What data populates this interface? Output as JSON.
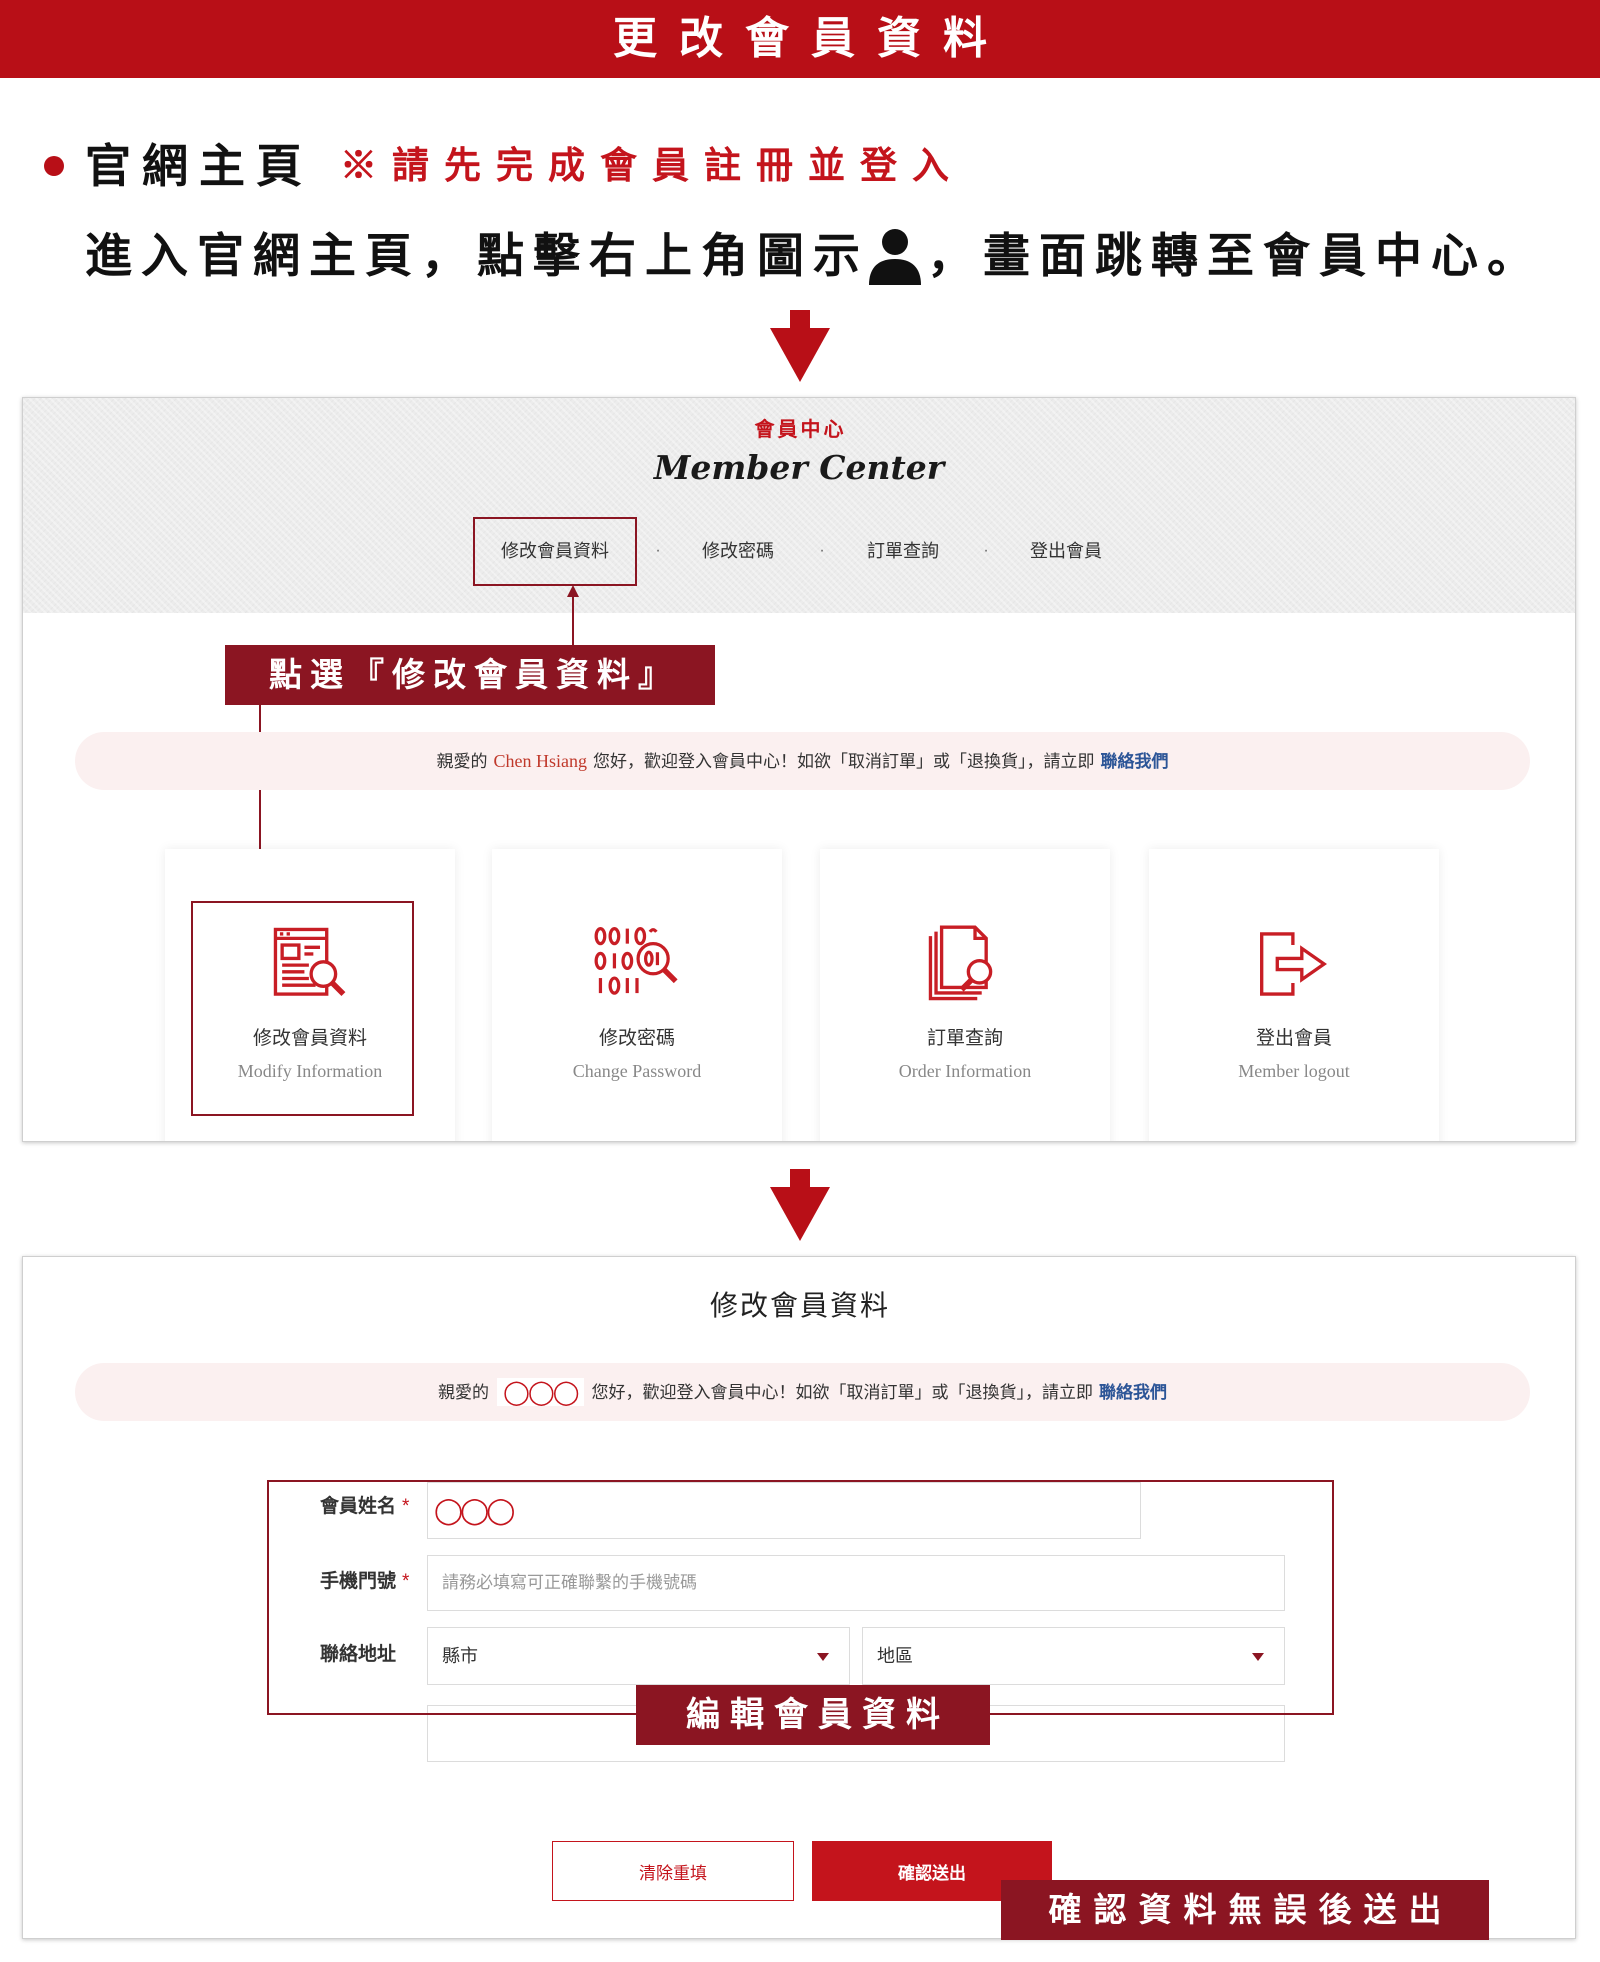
{
  "banner": {
    "title": "更改會員資料"
  },
  "intro": {
    "heading": "官網主頁",
    "note": "※請先完成會員註冊並登入",
    "instruction_before": "進入官網主頁，點擊右上角圖示",
    "instruction_icon": "user-icon",
    "instruction_after": "，畫面跳轉至會員中心。"
  },
  "member_center": {
    "subtitle": "會員中心",
    "title": "Member Center",
    "nav": [
      {
        "label": "修改會員資料"
      },
      {
        "label": "修改密碼"
      },
      {
        "label": "訂單查詢"
      },
      {
        "label": "登出會員"
      }
    ],
    "nav_separator": "·",
    "callout": "點選『修改會員資料』",
    "welcome": {
      "prefix": "親愛的",
      "name": "Chen Hsiang",
      "middle": "您好，歡迎登入會員中心！如欲「取消訂單」或「退換貨」，請立即",
      "link": "聯絡我們"
    },
    "cards": [
      {
        "icon": "document-search-icon",
        "label": "修改會員資料",
        "label_en": "Modify Information"
      },
      {
        "icon": "binary-search-icon",
        "label": "修改密碼",
        "label_en": "Change Password"
      },
      {
        "icon": "documents-search-icon",
        "label": "訂單查詢",
        "label_en": "Order Information"
      },
      {
        "icon": "logout-icon",
        "label": "登出會員",
        "label_en": "Member logout"
      }
    ]
  },
  "edit_form": {
    "title": "修改會員資料",
    "welcome": {
      "prefix": "親愛的",
      "name": "◯◯◯",
      "middle": "您好，歡迎登入會員中心！如欲「取消訂單」或「退換貨」，請立即",
      "link": "聯絡我們"
    },
    "fields": {
      "name": {
        "label": "會員姓名",
        "required": "*",
        "value": "◯◯◯"
      },
      "mobile": {
        "label": "手機門號",
        "required": "*",
        "placeholder": "請務必填寫可正確聯繫的手機號碼"
      },
      "address": {
        "label": "聯絡地址",
        "city": "縣市",
        "district": "地區"
      }
    },
    "callout": "編輯會員資料",
    "buttons": {
      "reset": "清除重填",
      "submit": "確認送出"
    },
    "submit_callout": "確認資料無誤後送出"
  },
  "colors": {
    "banner_red": "#b80f17",
    "callout_red": "#8b1522",
    "button_red": "#c4141c",
    "icon_red": "#c81e25",
    "link_blue": "#2c5597",
    "pill_bg": "#fbf0f0"
  }
}
